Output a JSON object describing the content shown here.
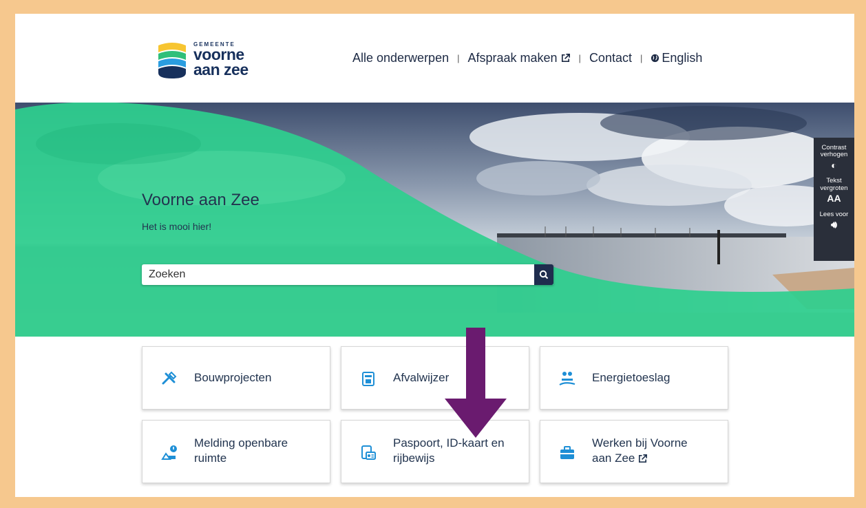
{
  "header": {
    "logo": {
      "small": "GEMEENTE",
      "line1": "voorne",
      "line2": "aan zee"
    },
    "nav": {
      "item1": "Alle onderwerpen",
      "item2": "Afspraak maken",
      "item3": "Contact",
      "item4": "English"
    }
  },
  "hero": {
    "title": "Voorne aan Zee",
    "subtitle": "Het is mooi hier!",
    "search_placeholder": "Zoeken"
  },
  "a11y": {
    "contrast_line1": "Contrast",
    "contrast_line2": "verhogen",
    "text_line1": "Tekst",
    "text_line2": "vergroten",
    "text_glyph": "AA",
    "read_label": "Lees voor"
  },
  "tiles": [
    {
      "line1": "Bouwprojecten",
      "line2": "",
      "icon": "tools-icon"
    },
    {
      "line1": "Afvalwijzer",
      "line2": "",
      "icon": "waste-bin-icon"
    },
    {
      "line1": "Energietoeslag",
      "line2": "",
      "icon": "energy-hand-icon"
    },
    {
      "line1": "Melding openbare",
      "line2": "ruimte",
      "icon": "report-icon"
    },
    {
      "line1": "Paspoort, ID-kaart en",
      "line2": "rijbewijs",
      "icon": "id-card-icon"
    },
    {
      "line1": "Werken bij Voorne",
      "line2": "aan Zee",
      "icon": "briefcase-icon"
    }
  ],
  "colors": {
    "brand_navy": "#17305c",
    "green_overlay": "#2ecf8e",
    "icon_blue": "#1e8fd6",
    "arrow_purple": "#6a1b6f",
    "frame_border": "#f6c88e"
  }
}
